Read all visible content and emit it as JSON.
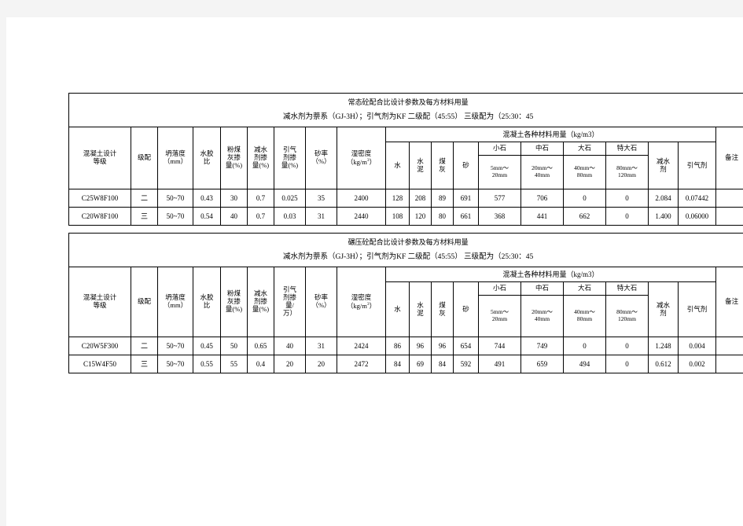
{
  "document": {
    "background_color": "#f4f4f4",
    "page_color": "#ffffff"
  },
  "tables": [
    {
      "id": "normal-concrete",
      "title": "常态砼配合比设计参数及每方材料用量",
      "subtitle": "减水剂为萘系（GJ-3H）；引气剂为KF  二级配（45:55）  三级配为（25:30：45",
      "headers": {
        "grade": "混凝土设计\n等级",
        "grade_l1": "混凝土设计",
        "grade_l2": "等级",
        "gradation": "级配",
        "slump_l1": "坍落度",
        "slump_l2": "（mm）",
        "wc_l1": "水胶",
        "wc_l2": "比",
        "flyash_l1": "粉煤",
        "flyash_l2": "灰掺",
        "flyash_l3": "量(%)",
        "reducer_l1": "减水",
        "reducer_l2": "剂掺",
        "reducer_l3": "量(%)",
        "air_l1": "引气",
        "air_l2": "剂掺",
        "air_l3": "量(%)",
        "sand_ratio_l1": "砂率",
        "sand_ratio_l2": "（%）",
        "density_l1": "湿密度",
        "density_l2": "（kg/m",
        "density_sup": "3",
        "density_l3": "）",
        "materials_group": "混凝土各种材料用量（kg/m3）",
        "water": "水",
        "cement_l1": "水",
        "cement_l2": "泥",
        "flyash_m_l1": "煤",
        "flyash_m_l2": "灰",
        "sand": "砂",
        "small_stone": "小石",
        "small_stone_range_l1": "5mm～",
        "small_stone_range_l2": "20mm",
        "mid_stone": "中石",
        "mid_stone_range_l1": "20mm～",
        "mid_stone_range_l2": "40mm",
        "large_stone": "大石",
        "large_stone_range_l1": "40mm～",
        "large_stone_range_l2": "80mm",
        "xlarge_stone": "特大石",
        "xlarge_stone_range_l1": "80mm～",
        "xlarge_stone_range_l2": "120mm",
        "reducer_m_l1": "减水",
        "reducer_m_l2": "剂",
        "air_m": "引气剂",
        "remark": "备注"
      },
      "rows": [
        {
          "grade": "C25W8F100",
          "gradation": "二",
          "slump": "50~70",
          "wc_ratio": "0.43",
          "flyash_pct": "30",
          "reducer_pct": "0.7",
          "air_pct": "0.025",
          "sand_ratio": "35",
          "density": "2400",
          "water": "128",
          "cement": "208",
          "flyash": "89",
          "sand": "691",
          "small_stone": "577",
          "mid_stone": "706",
          "large_stone": "0",
          "xlarge_stone": "0",
          "reducer": "2.084",
          "air_agent": "0.07442",
          "remark": ""
        },
        {
          "grade": "C20W8F100",
          "gradation": "三",
          "slump": "50~70",
          "wc_ratio": "0.54",
          "flyash_pct": "40",
          "reducer_pct": "0.7",
          "air_pct": "0.03",
          "sand_ratio": "31",
          "density": "2440",
          "water": "108",
          "cement": "120",
          "flyash": "80",
          "sand": "661",
          "small_stone": "368",
          "mid_stone": "441",
          "large_stone": "662",
          "xlarge_stone": "0",
          "reducer": "1.400",
          "air_agent": "0.06000",
          "remark": ""
        }
      ]
    },
    {
      "id": "rcc-concrete",
      "title": "碾压砼配合比设计参数及每方材料用量",
      "subtitle": "减水剂为萘系（GJ-3H）；引气剂为KF  二级配（45:55）  三级配为（25:30：45",
      "headers": {
        "grade_l1": "混凝土设计",
        "grade_l2": "等级",
        "gradation": "级配",
        "slump_l1": "坍落度",
        "slump_l2": "（mm）",
        "wc_l1": "水胶",
        "wc_l2": "比",
        "flyash_l1": "粉煤",
        "flyash_l2": "灰掺",
        "flyash_l3": "量(%)",
        "reducer_l1": "减水",
        "reducer_l2": "剂掺",
        "reducer_l3": "量(%)",
        "air_l1": "引气",
        "air_l2": "剂掺",
        "air_l3": "量/",
        "air_l4": "万）",
        "sand_ratio_l1": "砂率",
        "sand_ratio_l2": "（%）",
        "density_l1": "湿密度",
        "density_l2": "（kg/m",
        "density_sup": "3",
        "density_l3": "）",
        "materials_group": "混凝土各种材料用量（kg/m3）",
        "water": "水",
        "cement_l1": "水",
        "cement_l2": "泥",
        "flyash_m_l1": "煤",
        "flyash_m_l2": "灰",
        "sand": "砂",
        "small_stone": "小石",
        "small_stone_range_l1": "5mm～",
        "small_stone_range_l2": "20mm",
        "mid_stone": "中石",
        "mid_stone_range_l1": "20mm～",
        "mid_stone_range_l2": "40mm",
        "large_stone": "大石",
        "large_stone_range_l1": "40mm～",
        "large_stone_range_l2": "80mm",
        "xlarge_stone": "特大石",
        "xlarge_stone_range_l1": "80mm～",
        "xlarge_stone_range_l2": "120mm",
        "reducer_m_l1": "减水",
        "reducer_m_l2": "剂",
        "air_m": "引气剂",
        "remark": "备注"
      },
      "rows": [
        {
          "grade": "C20W5F300",
          "gradation": "二",
          "slump": "50~70",
          "wc_ratio": "0.45",
          "flyash_pct": "50",
          "reducer_pct": "0.65",
          "air_pct": "40",
          "sand_ratio": "31",
          "density": "2424",
          "water": "86",
          "cement": "96",
          "flyash": "96",
          "sand": "654",
          "small_stone": "744",
          "mid_stone": "749",
          "large_stone": "0",
          "xlarge_stone": "0",
          "reducer": "1.248",
          "air_agent": "0.004",
          "remark": ""
        },
        {
          "grade": "C15W4F50",
          "gradation": "三",
          "slump": "50~70",
          "wc_ratio": "0.55",
          "flyash_pct": "55",
          "reducer_pct": "0.4",
          "air_pct": "20",
          "sand_ratio": "20",
          "density": "2472",
          "water": "84",
          "cement": "69",
          "flyash": "84",
          "sand": "592",
          "small_stone": "491",
          "mid_stone": "659",
          "large_stone": "494",
          "xlarge_stone": "0",
          "reducer": "0.612",
          "air_agent": "0.002",
          "remark": ""
        }
      ]
    }
  ]
}
